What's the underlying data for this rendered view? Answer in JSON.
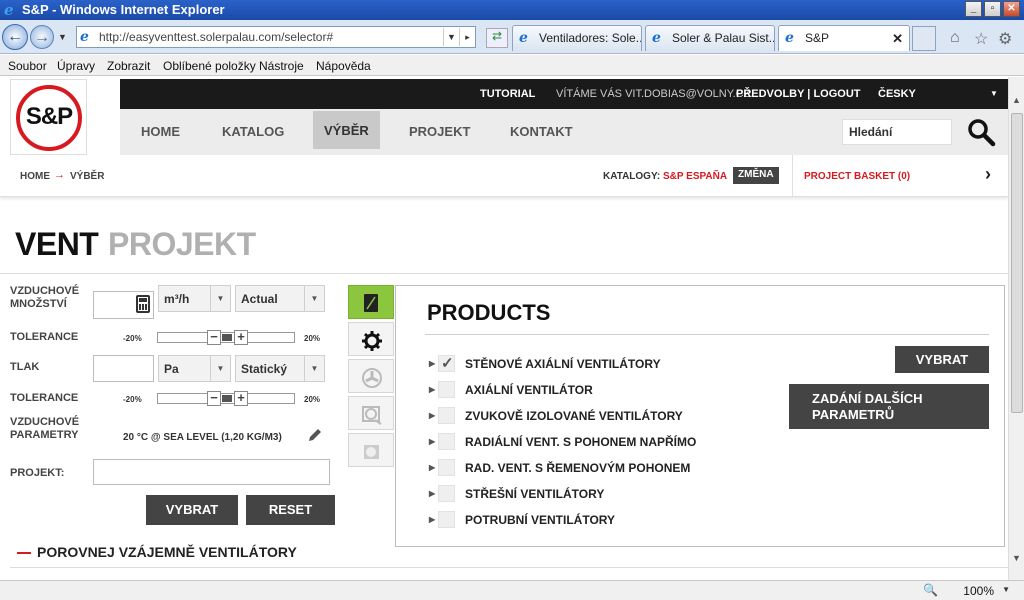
{
  "browser": {
    "title": "S&P - Windows Internet Explorer",
    "url": "http://easyventtest.solerpalau.com/selector#",
    "tabs": [
      {
        "label": "Ventiladores: Sole..."
      },
      {
        "label": "Soler & Palau Sist..."
      },
      {
        "label": "S&P"
      }
    ],
    "menu": [
      "Soubor",
      "Úpravy",
      "Zobrazit",
      "Oblíbené položky",
      "Nástroje",
      "Nápověda"
    ],
    "zoom": "100%"
  },
  "site": {
    "logo_text": "S&P",
    "topbar": {
      "tutorial": "TUTORIAL",
      "welcome": "VÍTÁME VÁS VIT.DOBIAS@VOLNY.CZ.",
      "prefs": "PŘEDVOLBY | LOGOUT",
      "language": "ČESKY"
    },
    "nav": [
      {
        "label": "HOME"
      },
      {
        "label": "KATALOG"
      },
      {
        "label": "VÝBĚR"
      },
      {
        "label": "PROJEKT"
      },
      {
        "label": "KONTAKT"
      }
    ],
    "search_placeholder": "Hledání",
    "breadcrumb": {
      "home": "HOME",
      "current": "VÝBĚR"
    },
    "katalog_label": "KATALOGY:",
    "katalog_value": "S&P ESPAÑA",
    "zmena": "ZMĚNA",
    "basket": "PROJECT BASKET (0)"
  },
  "page": {
    "heading_a": "VENT",
    "heading_b": "PROJEKT",
    "form": {
      "airflow_label": "VZDUCHOVÉ MNOŽSTVÍ",
      "airflow_unit": "m³/h",
      "airflow_mode": "Actual",
      "tolerance_label": "TOLERANCE",
      "tol_min": "-20%",
      "tol_max": "20%",
      "pressure_label": "TLAK",
      "pressure_unit": "Pa",
      "pressure_mode": "Statický",
      "air_params_label": "VZDUCHOVÉ PARAMETRY",
      "air_params_value": "20 °C @ SEA LEVEL (1,20 KG/M3)",
      "project_label": "PROJEKT:",
      "vybrat": "VYBRAT",
      "reset": "RESET"
    },
    "compare": "POROVNEJ VZÁJEMNĚ VENTILÁTORY",
    "products": {
      "title": "PRODUCTS",
      "items": [
        {
          "label": "STĚNOVÉ AXIÁLNÍ VENTILÁTORY",
          "checked": true
        },
        {
          "label": "AXIÁLNÍ VENTILÁTOR",
          "checked": false
        },
        {
          "label": "ZVUKOVĚ IZOLOVANÉ VENTILÁTORY",
          "checked": false
        },
        {
          "label": "RADIÁLNÍ VENT. S POHONEM NAPŘÍMO",
          "checked": false
        },
        {
          "label": "RAD. VENT. S ŘEMENOVÝM POHONEM",
          "checked": false
        },
        {
          "label": "STŘEŠNÍ VENTILÁTORY",
          "checked": false
        },
        {
          "label": "POTRUBNÍ VENTILÁTORY",
          "checked": false
        }
      ],
      "vybrat": "VYBRAT",
      "more_params": "ZADÁNÍ DALŠÍCH PARAMETRŮ"
    }
  }
}
